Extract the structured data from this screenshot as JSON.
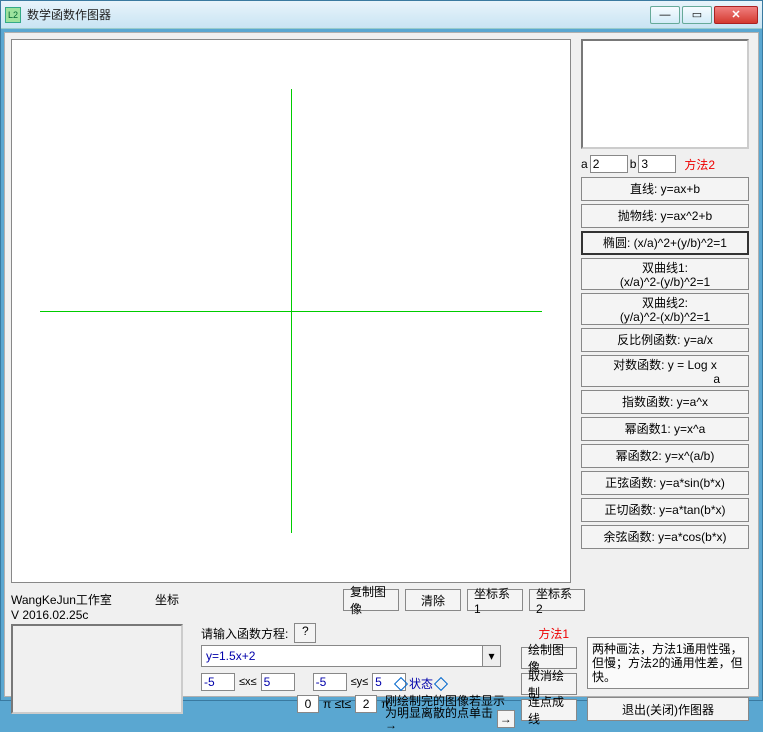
{
  "window": {
    "title": "数学函数作图器",
    "app_icon_text": "L2"
  },
  "params": {
    "a_label": "a",
    "a_value": "2",
    "b_label": "b",
    "b_value": "3",
    "method2_label": "方法2"
  },
  "function_buttons": {
    "line": "直线: y=ax+b",
    "parabola": "抛物线: y=ax^2+b",
    "ellipse": "椭圆: (x/a)^2+(y/b)^2=1",
    "hyperbola1_l1": "双曲线1:",
    "hyperbola1_l2": "(x/a)^2-(y/b)^2=1",
    "hyperbola2_l1": "双曲线2:",
    "hyperbola2_l2": "(y/a)^2-(x/b)^2=1",
    "inverse": "反比例函数: y=a/x",
    "log_l1": "对数函数: y = Log  x",
    "log_l2": "a",
    "exp": "指数函数: y=a^x",
    "power1": "幂函数1: y=x^a",
    "power2": "幂函数2: y=x^(a/b)",
    "sin": "正弦函数: y=a*sin(b*x)",
    "tan": "正切函数: y=a*tan(b*x)",
    "cos": "余弦函数: y=a*cos(b*x)"
  },
  "bottom": {
    "workshop_l1": "WangKeJun工作室",
    "workshop_l2": "V 2016.02.25c",
    "coord_label": "坐标"
  },
  "toolbar": {
    "copy": "复制图像",
    "clear": "清除",
    "axis1": "坐标系1",
    "axis2": "坐标系2"
  },
  "method1": {
    "prompt": "请输入函数方程:",
    "question": "?",
    "label": "方法1",
    "equation": "y=1.5x+2",
    "x_low": "-5",
    "x_high": "5",
    "x_var": "≤x≤",
    "y_low": "-5",
    "y_high": "5",
    "y_var": "≤y≤",
    "t_low": "0",
    "t_mid": "π ≤t≤",
    "t_high": "2",
    "t_unit": "π",
    "status": "状态",
    "hint_l1": "刚绘制完的图像若显示",
    "hint_l2": "为明显离散的点单击→",
    "draw": "绘制图像",
    "cancel": "取消绘制",
    "connect": "连点成线"
  },
  "info": {
    "text": "两种画法，方法1通用性强，但慢；方法2的通用性差，但快。"
  },
  "exit": {
    "label": "退出(关闭)作图器"
  }
}
